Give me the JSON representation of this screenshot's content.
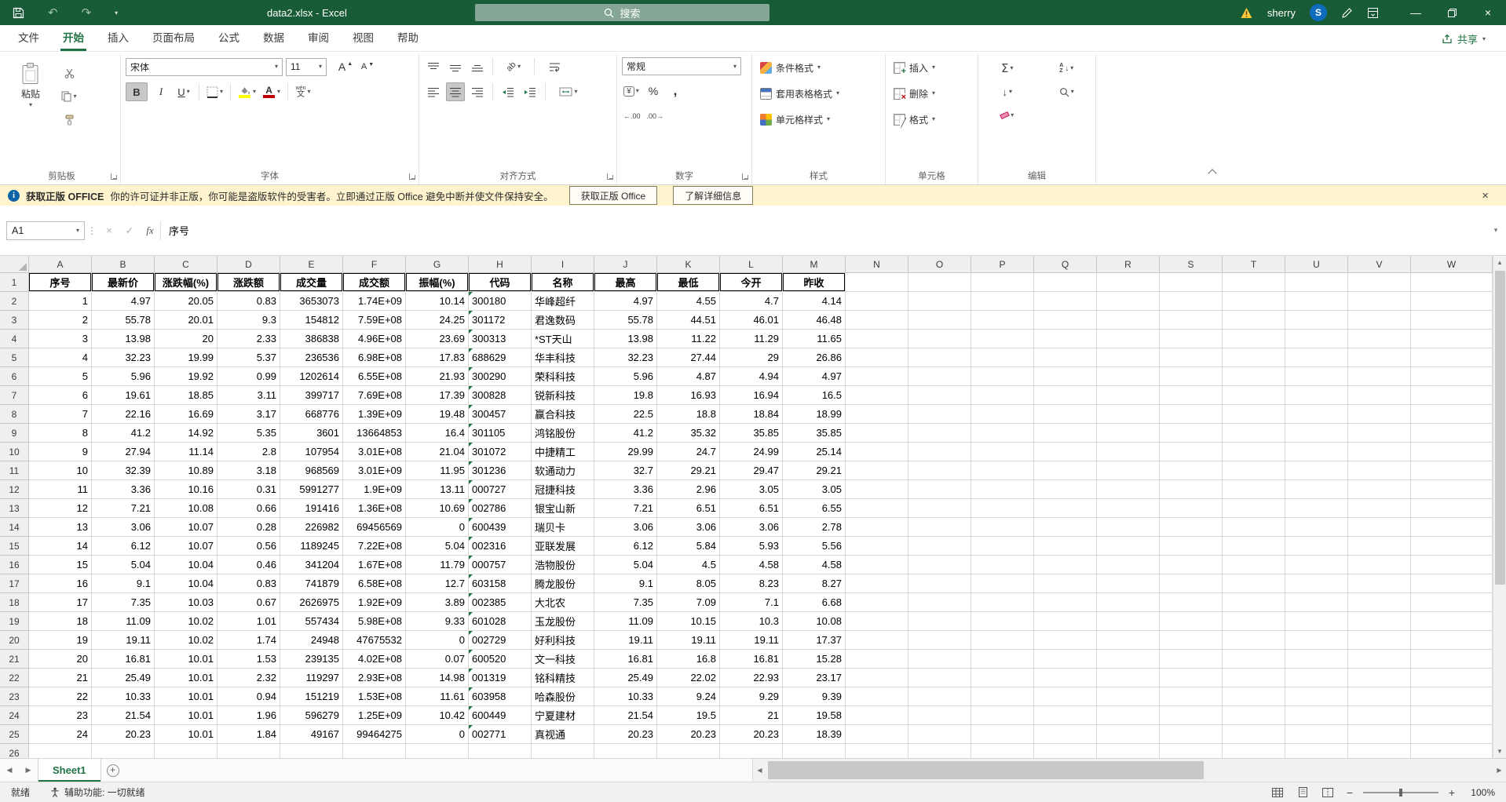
{
  "colors": {
    "accent": "#217346",
    "titlebar_green": "#185C37",
    "warning_bg": "#FFF4CE",
    "fill_yellow": "#FFFF00",
    "font_red": "#C00000",
    "avatar_blue": "#0F6CBD"
  },
  "titlebar": {
    "title": "data2.xlsx - Excel",
    "search": "搜索",
    "user": "sherry",
    "user_initial": "S"
  },
  "tabs": {
    "items": [
      "文件",
      "开始",
      "插入",
      "页面布局",
      "公式",
      "数据",
      "审阅",
      "视图",
      "帮助"
    ],
    "active": "开始",
    "share": "共享"
  },
  "ribbon": {
    "clipboard": {
      "label": "剪贴板",
      "paste": "粘贴"
    },
    "font": {
      "label": "字体",
      "name": "宋体",
      "size": "11"
    },
    "alignment": {
      "label": "对齐方式"
    },
    "number": {
      "label": "数字",
      "format": "常规"
    },
    "styles": {
      "label": "样式",
      "conditional": "条件格式",
      "table": "套用表格格式",
      "cell": "单元格样式"
    },
    "cells": {
      "label": "单元格",
      "insert": "插入",
      "delete": "删除",
      "format": "格式"
    },
    "editing": {
      "label": "编辑"
    }
  },
  "message_bar": {
    "title": "获取正版 OFFICE",
    "text": "你的许可证并非正版，你可能是盗版软件的受害者。立即通过正版 Office 避免中断并使文件保持安全。",
    "button1": "获取正版 Office",
    "button2": "了解详细信息"
  },
  "formula_bar": {
    "name_box": "A1",
    "value": "序号"
  },
  "sheet": {
    "columns": [
      "A",
      "B",
      "C",
      "D",
      "E",
      "F",
      "G",
      "H",
      "I",
      "J",
      "K",
      "L",
      "M",
      "N",
      "O",
      "P",
      "Q",
      "R",
      "S",
      "T",
      "U",
      "V",
      "W"
    ],
    "header_row": [
      "序号",
      "最新价",
      "涨跌幅(%)",
      "涨跌额",
      "成交量",
      "成交额",
      "振幅(%)",
      "代码",
      "名称",
      "最高",
      "最低",
      "今开",
      "昨收"
    ],
    "rows": [
      [
        "1",
        "4.97",
        "20.05",
        "0.83",
        "3653073",
        "1.74E+09",
        "10.14",
        "300180",
        "华峰超纤",
        "4.97",
        "4.55",
        "4.7",
        "4.14"
      ],
      [
        "2",
        "55.78",
        "20.01",
        "9.3",
        "154812",
        "7.59E+08",
        "24.25",
        "301172",
        "君逸数码",
        "55.78",
        "44.51",
        "46.01",
        "46.48"
      ],
      [
        "3",
        "13.98",
        "20",
        "2.33",
        "386838",
        "4.96E+08",
        "23.69",
        "300313",
        "*ST天山",
        "13.98",
        "11.22",
        "11.29",
        "11.65"
      ],
      [
        "4",
        "32.23",
        "19.99",
        "5.37",
        "236536",
        "6.98E+08",
        "17.83",
        "688629",
        "华丰科技",
        "32.23",
        "27.44",
        "29",
        "26.86"
      ],
      [
        "5",
        "5.96",
        "19.92",
        "0.99",
        "1202614",
        "6.55E+08",
        "21.93",
        "300290",
        "荣科科技",
        "5.96",
        "4.87",
        "4.94",
        "4.97"
      ],
      [
        "6",
        "19.61",
        "18.85",
        "3.11",
        "399717",
        "7.69E+08",
        "17.39",
        "300828",
        "锐新科技",
        "19.8",
        "16.93",
        "16.94",
        "16.5"
      ],
      [
        "7",
        "22.16",
        "16.69",
        "3.17",
        "668776",
        "1.39E+09",
        "19.48",
        "300457",
        "赢合科技",
        "22.5",
        "18.8",
        "18.84",
        "18.99"
      ],
      [
        "8",
        "41.2",
        "14.92",
        "5.35",
        "3601",
        "13664853",
        "16.4",
        "301105",
        "鸿铭股份",
        "41.2",
        "35.32",
        "35.85",
        "35.85"
      ],
      [
        "9",
        "27.94",
        "11.14",
        "2.8",
        "107954",
        "3.01E+08",
        "21.04",
        "301072",
        "中捷精工",
        "29.99",
        "24.7",
        "24.99",
        "25.14"
      ],
      [
        "10",
        "32.39",
        "10.89",
        "3.18",
        "968569",
        "3.01E+09",
        "11.95",
        "301236",
        "软通动力",
        "32.7",
        "29.21",
        "29.47",
        "29.21"
      ],
      [
        "11",
        "3.36",
        "10.16",
        "0.31",
        "5991277",
        "1.9E+09",
        "13.11",
        "000727",
        "冠捷科技",
        "3.36",
        "2.96",
        "3.05",
        "3.05"
      ],
      [
        "12",
        "7.21",
        "10.08",
        "0.66",
        "191416",
        "1.36E+08",
        "10.69",
        "002786",
        "银宝山新",
        "7.21",
        "6.51",
        "6.51",
        "6.55"
      ],
      [
        "13",
        "3.06",
        "10.07",
        "0.28",
        "226982",
        "69456569",
        "0",
        "600439",
        "瑞贝卡",
        "3.06",
        "3.06",
        "3.06",
        "2.78"
      ],
      [
        "14",
        "6.12",
        "10.07",
        "0.56",
        "1189245",
        "7.22E+08",
        "5.04",
        "002316",
        "亚联发展",
        "6.12",
        "5.84",
        "5.93",
        "5.56"
      ],
      [
        "15",
        "5.04",
        "10.04",
        "0.46",
        "341204",
        "1.67E+08",
        "11.79",
        "000757",
        "浩物股份",
        "5.04",
        "4.5",
        "4.58",
        "4.58"
      ],
      [
        "16",
        "9.1",
        "10.04",
        "0.83",
        "741879",
        "6.58E+08",
        "12.7",
        "603158",
        "腾龙股份",
        "9.1",
        "8.05",
        "8.23",
        "8.27"
      ],
      [
        "17",
        "7.35",
        "10.03",
        "0.67",
        "2626975",
        "1.92E+09",
        "3.89",
        "002385",
        "大北农",
        "7.35",
        "7.09",
        "7.1",
        "6.68"
      ],
      [
        "18",
        "11.09",
        "10.02",
        "1.01",
        "557434",
        "5.98E+08",
        "9.33",
        "601028",
        "玉龙股份",
        "11.09",
        "10.15",
        "10.3",
        "10.08"
      ],
      [
        "19",
        "19.11",
        "10.02",
        "1.74",
        "24948",
        "47675532",
        "0",
        "002729",
        "好利科技",
        "19.11",
        "19.11",
        "19.11",
        "17.37"
      ],
      [
        "20",
        "16.81",
        "10.01",
        "1.53",
        "239135",
        "4.02E+08",
        "0.07",
        "600520",
        "文一科技",
        "16.81",
        "16.8",
        "16.81",
        "15.28"
      ],
      [
        "21",
        "25.49",
        "10.01",
        "2.32",
        "119297",
        "2.93E+08",
        "14.98",
        "001319",
        "铭科精技",
        "25.49",
        "22.02",
        "22.93",
        "23.17"
      ],
      [
        "22",
        "10.33",
        "10.01",
        "0.94",
        "151219",
        "1.53E+08",
        "11.61",
        "603958",
        "哈森股份",
        "10.33",
        "9.24",
        "9.29",
        "9.39"
      ],
      [
        "23",
        "21.54",
        "10.01",
        "1.96",
        "596279",
        "1.25E+09",
        "10.42",
        "600449",
        "宁夏建材",
        "21.54",
        "19.5",
        "21",
        "19.58"
      ],
      [
        "24",
        "20.23",
        "10.01",
        "1.84",
        "49167",
        "99464275",
        "0",
        "002771",
        "真视通",
        "20.23",
        "20.23",
        "20.23",
        "18.39"
      ]
    ]
  },
  "sheet_bar": {
    "active_tab": "Sheet1"
  },
  "status_bar": {
    "left": "就绪",
    "accessibility": "辅助功能: 一切就绪",
    "zoom": "100%"
  }
}
